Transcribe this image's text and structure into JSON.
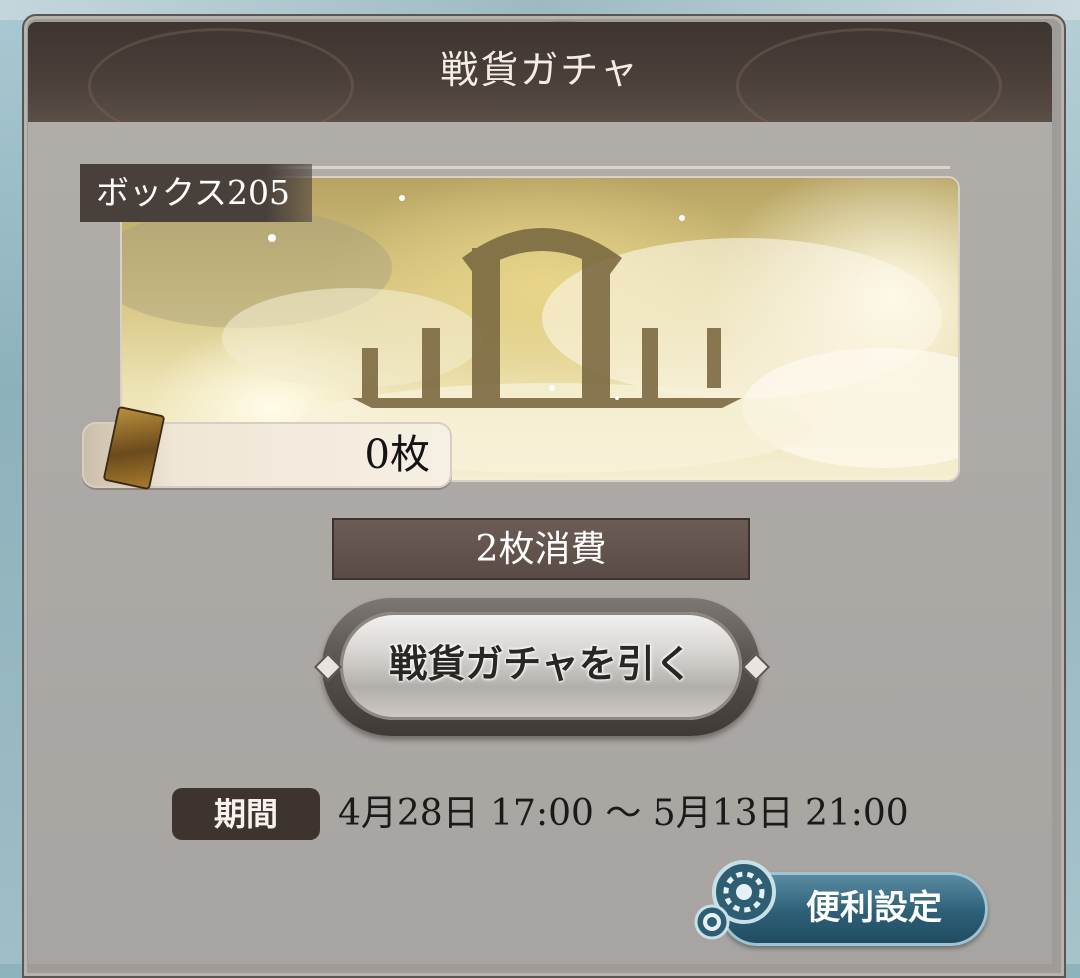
{
  "dialog": {
    "title": "戦貨ガチャ"
  },
  "banner": {
    "box_label": "ボックス205",
    "ticket_count": "0枚",
    "ticket_icon": "ticket-icon"
  },
  "draw": {
    "cost_label": "2枚消費",
    "button_label": "戦貨ガチャを引く"
  },
  "period": {
    "tag": "期間",
    "text": "4月28日 17:00 〜 5月13日 21:00"
  },
  "settings": {
    "button_label": "便利設定",
    "icon": "gear-icon"
  },
  "colors": {
    "title_bar": "#4b403a",
    "panel": "#a8a4a1",
    "cost_bar": "#5a4c45",
    "settings_button": "#2d5f77"
  }
}
